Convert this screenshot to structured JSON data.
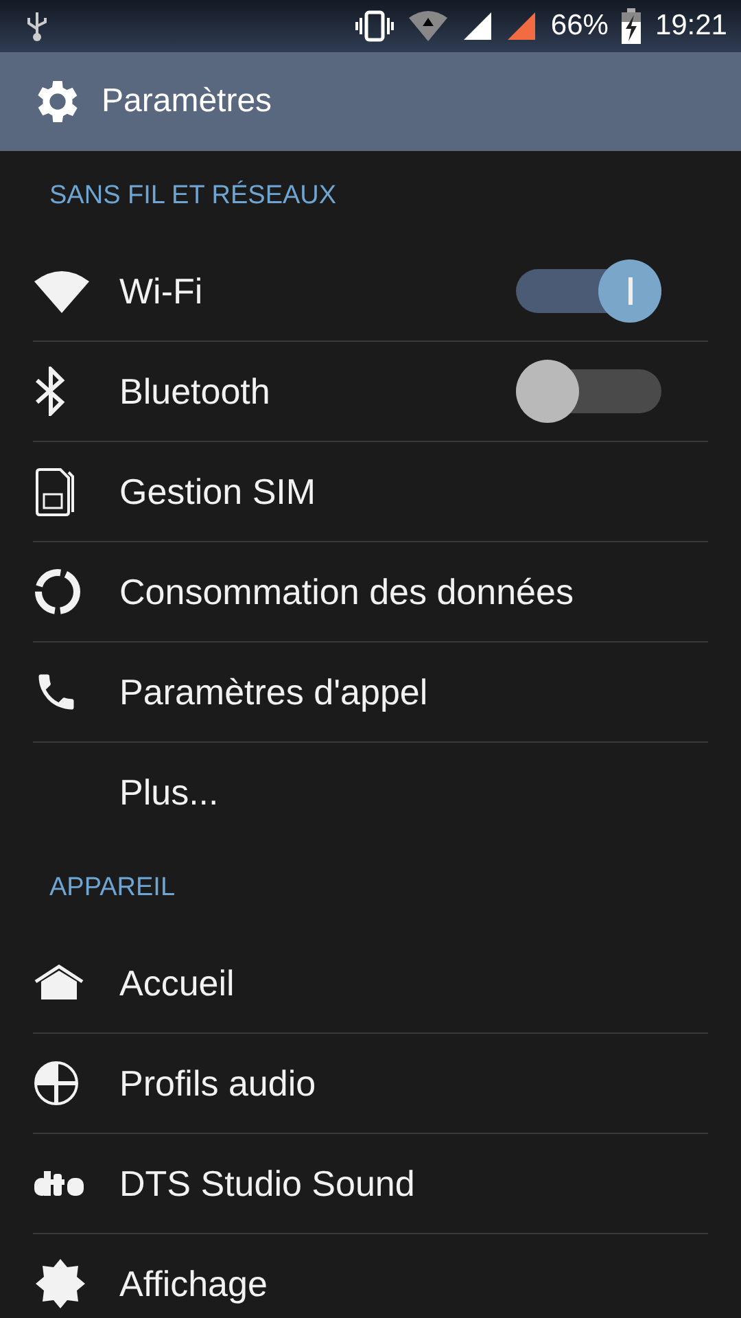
{
  "status_bar": {
    "battery": "66%",
    "time": "19:21"
  },
  "app_bar": {
    "title": "Paramètres"
  },
  "sections": [
    {
      "header": "SANS FIL ET RÉSEAUX",
      "items": [
        {
          "kind": "switch",
          "label": "Wi-Fi",
          "on": true
        },
        {
          "kind": "switch",
          "label": "Bluetooth",
          "on": false
        },
        {
          "kind": "link",
          "label": "Gestion SIM"
        },
        {
          "kind": "link",
          "label": "Consommation des données"
        },
        {
          "kind": "link",
          "label": "Paramètres d'appel"
        },
        {
          "kind": "link",
          "label": "Plus..."
        }
      ]
    },
    {
      "header": "APPAREIL",
      "items": [
        {
          "kind": "link",
          "label": "Accueil"
        },
        {
          "kind": "link",
          "label": "Profils audio"
        },
        {
          "kind": "link",
          "label": "DTS Studio Sound"
        },
        {
          "kind": "link",
          "label": "Affichage"
        }
      ]
    }
  ]
}
